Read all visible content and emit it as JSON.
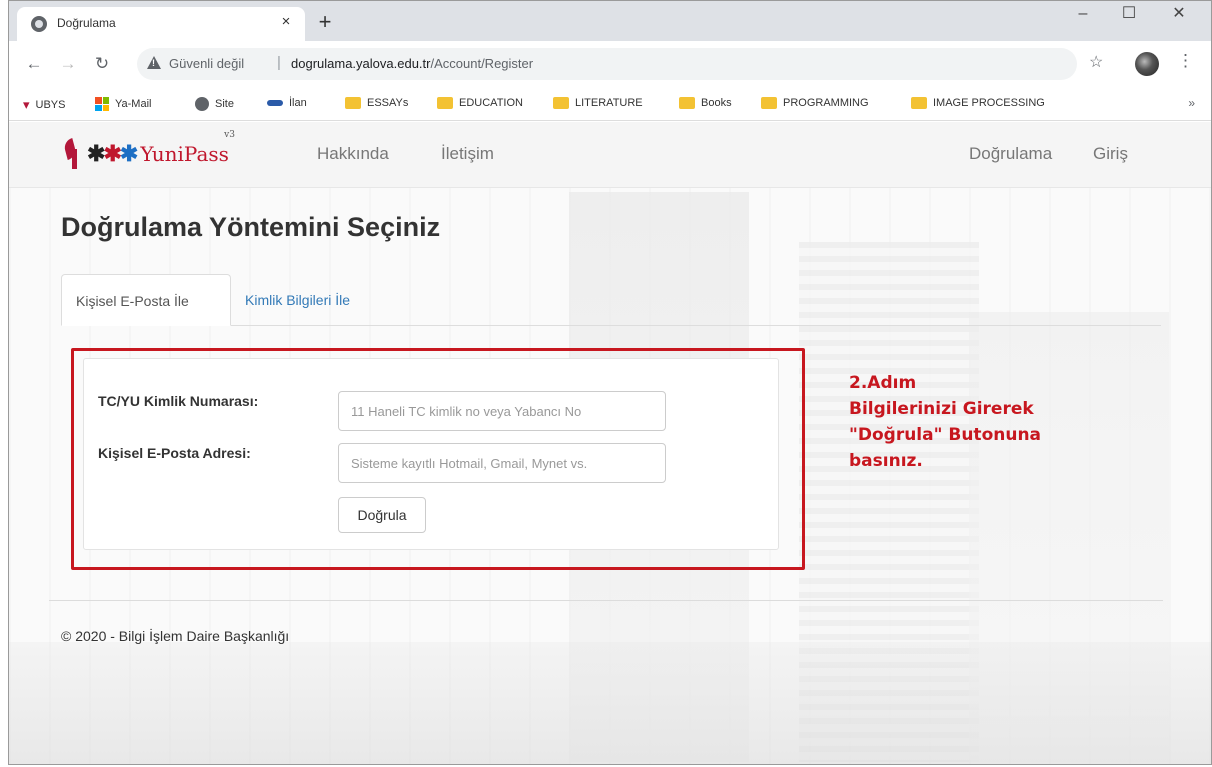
{
  "browser": {
    "tab_title": "Doğrulama",
    "tab_close": "×",
    "new_tab": "+",
    "controls": {
      "minimize": "–",
      "maximize": "☐",
      "close": "✕"
    },
    "security_label": "Güvenli değil",
    "separator": "|",
    "url_host": "dogrulama.yalova.edu.tr",
    "url_path": "/Account/Register",
    "bookmarks": [
      "UBYS",
      "Ya-Mail",
      "Site",
      "İlan",
      "ESSAYs",
      "EDUCATION",
      "LITERATURE",
      "Books",
      "PROGRAMMING",
      "IMAGE PROCESSING"
    ],
    "bookmarks_more": "»"
  },
  "navbar": {
    "brand": "YuniPass",
    "brand_version": "v3",
    "links": [
      "Hakkında",
      "İletişim",
      "Doğrulama",
      "Giriş"
    ]
  },
  "main": {
    "heading": "Doğrulama Yöntemini Seçiniz",
    "tabs": [
      {
        "label": "Kişisel E-Posta İle",
        "active": true
      },
      {
        "label": "Kimlik Bilgileri İle",
        "active": false
      }
    ],
    "form": {
      "tc_label": "TC/YU Kimlik Numarası:",
      "tc_placeholder": "11 Haneli TC kimlik no veya Yabancı No",
      "tc_value": "",
      "email_label": "Kişisel E-Posta Adresi:",
      "email_placeholder": "Sisteme kayıtlı Hotmail, Gmail, Mynet vs.",
      "email_value": "",
      "submit_label": "Doğrula"
    },
    "annotation": [
      "2.Adım",
      "Bilgilerinizi Girerek",
      "\"Doğrula\" Butonuna",
      "basınız."
    ]
  },
  "footer": {
    "text": "© 2020 - Bilgi İşlem Daire Başkanlığı"
  },
  "colors": {
    "annotation_red": "#c7171f",
    "link_blue": "#337ab7",
    "brand_red": "#c0172d"
  }
}
